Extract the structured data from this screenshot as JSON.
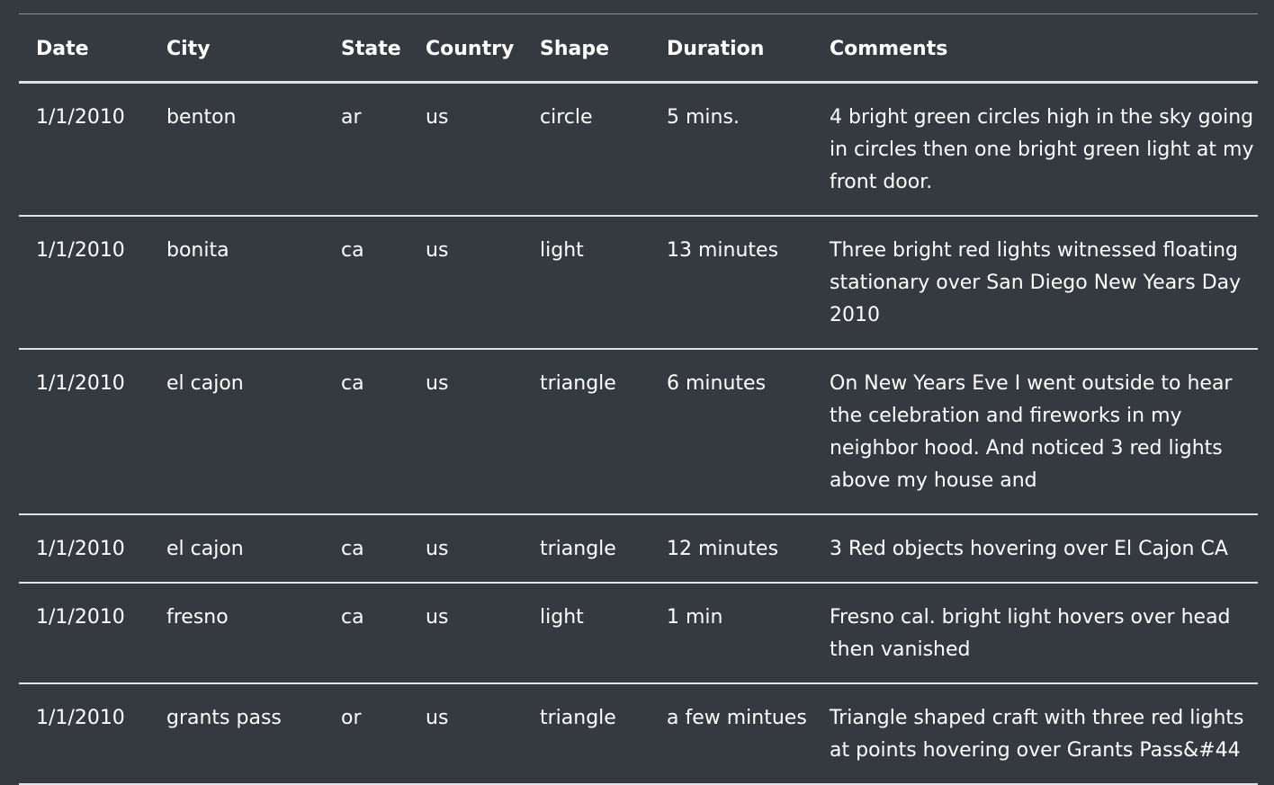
{
  "table": {
    "headers": [
      "Date",
      "City",
      "State",
      "Country",
      "Shape",
      "Duration",
      "Comments"
    ],
    "rows": [
      [
        "1/1/2010",
        "benton",
        "ar",
        "us",
        "circle",
        "5 mins.",
        "4 bright green circles high in the sky going in circles then one bright green light at my front door."
      ],
      [
        "1/1/2010",
        "bonita",
        "ca",
        "us",
        "light",
        "13 minutes",
        "Three bright red lights witnessed floating stationary over San Diego New Years Day 2010"
      ],
      [
        "1/1/2010",
        "el cajon",
        "ca",
        "us",
        "triangle",
        "6 minutes",
        "On New Years Eve I went outside to hear the celebration and fireworks in my neighbor hood. And noticed 3 red lights above my house and"
      ],
      [
        "1/1/2010",
        "el cajon",
        "ca",
        "us",
        "triangle",
        "12 minutes",
        "3 Red objects hovering over El Cajon CA"
      ],
      [
        "1/1/2010",
        "fresno",
        "ca",
        "us",
        "light",
        "1 min",
        "Fresno cal. bright light hovers over head then vanished"
      ],
      [
        "1/1/2010",
        "grants pass",
        "or",
        "us",
        "triangle",
        "a few mintues",
        "Triangle shaped craft with three red lights at points hovering over Grants Pass&#44"
      ]
    ]
  }
}
